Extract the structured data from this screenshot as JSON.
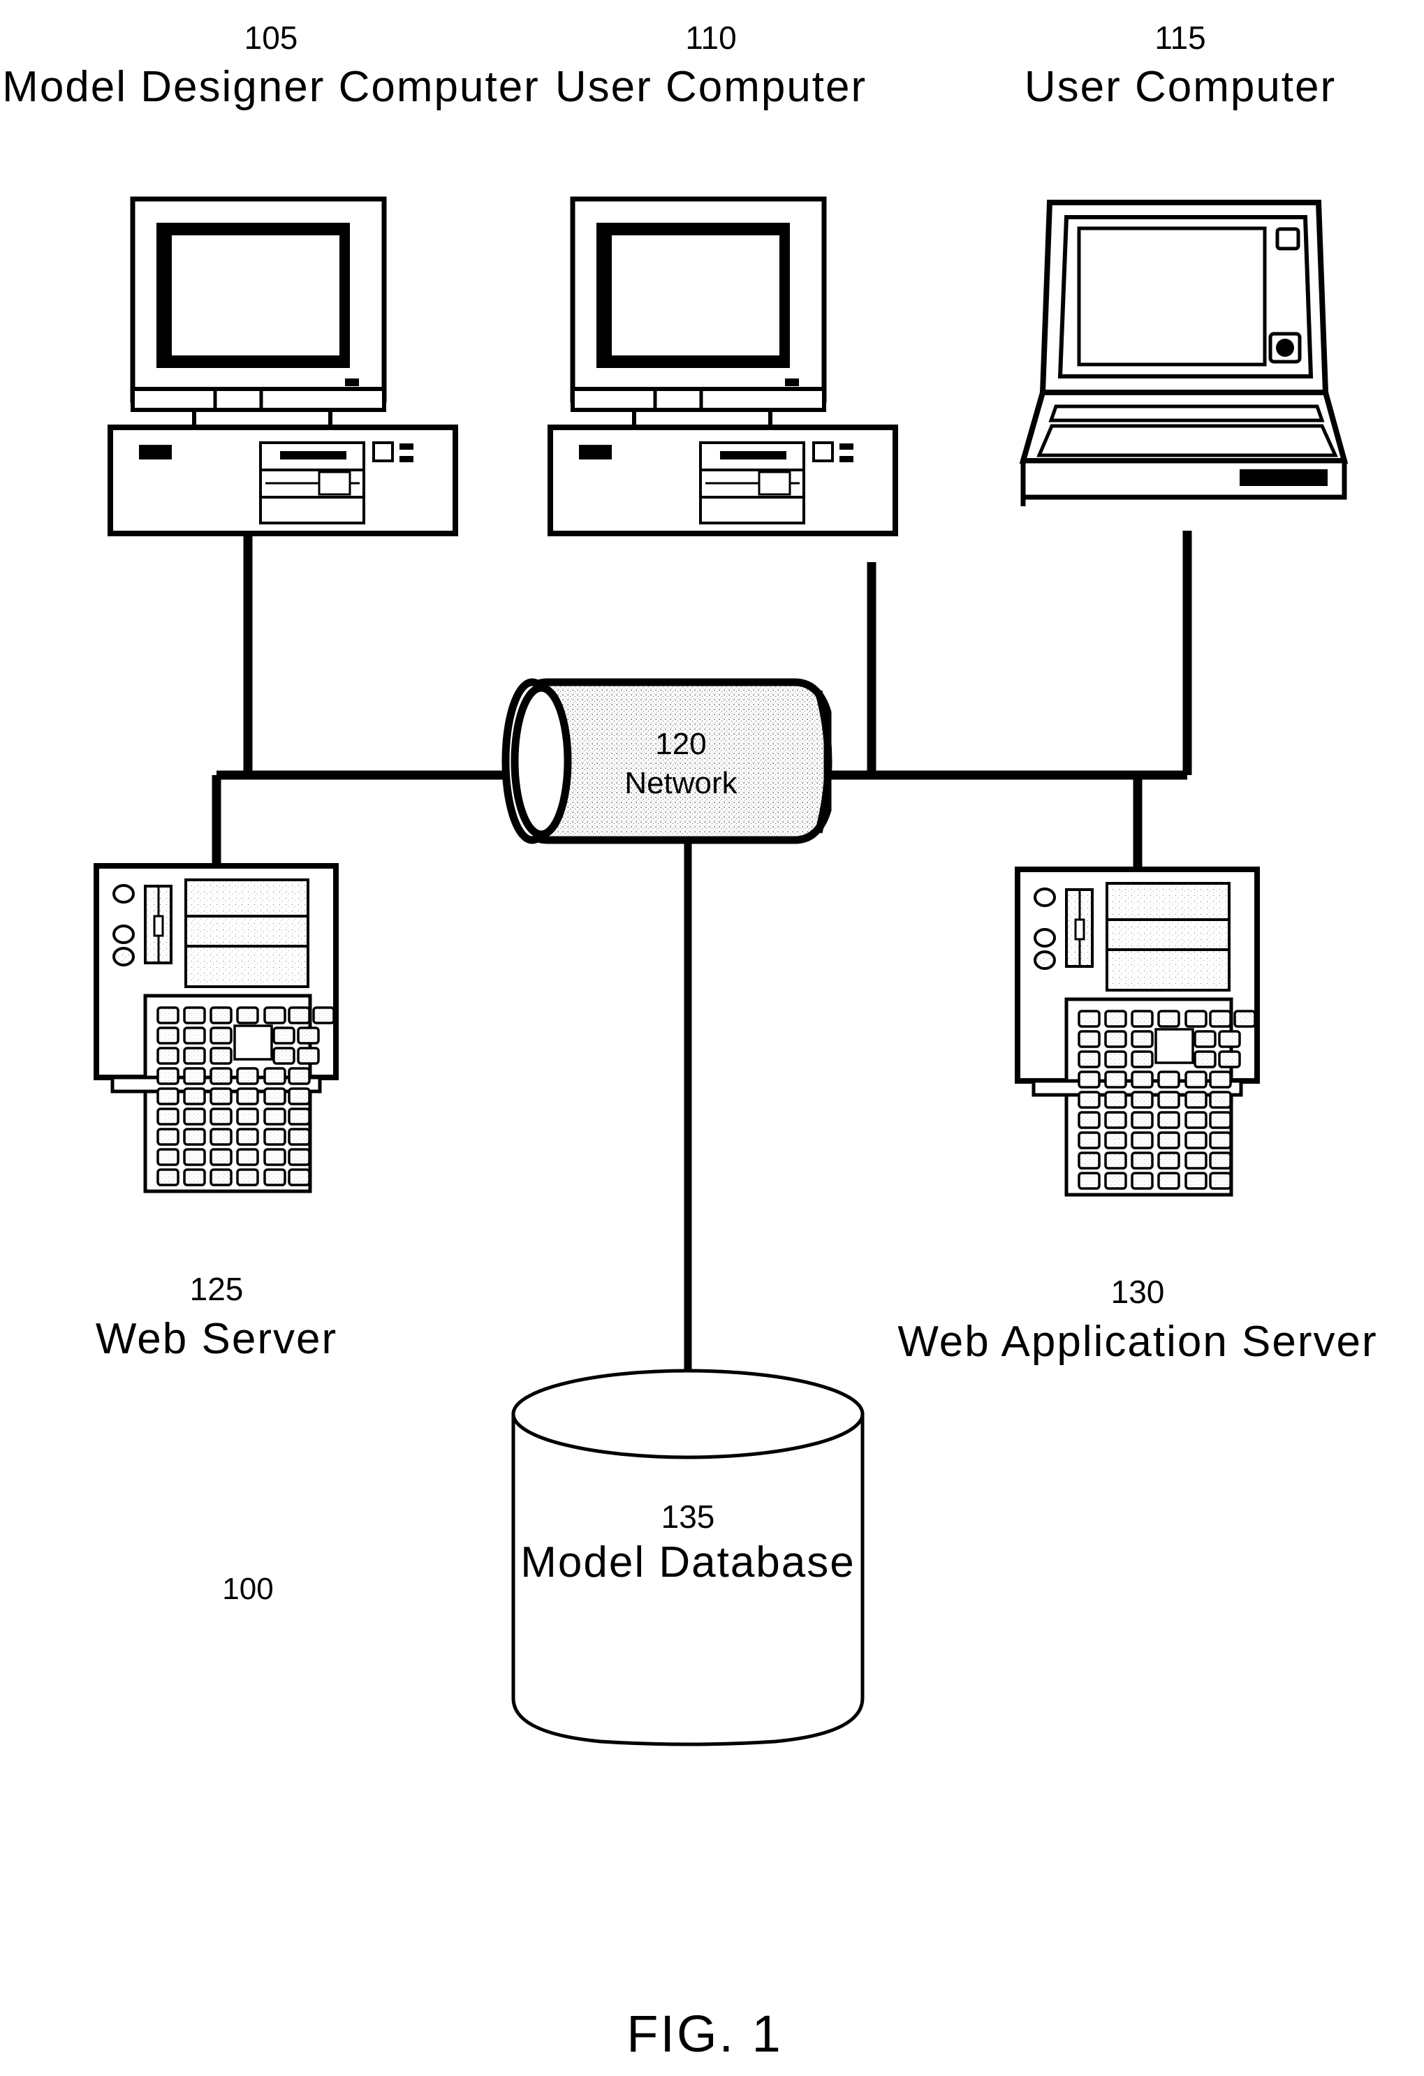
{
  "figure": {
    "caption": "FIG. 1",
    "system_ref": "100"
  },
  "nodes": [
    {
      "id": "model-designer-computer",
      "ref": "105",
      "label": "Model Designer Computer",
      "kind": "desktop-computer"
    },
    {
      "id": "user-computer-110",
      "ref": "110",
      "label": "User Computer",
      "kind": "desktop-computer"
    },
    {
      "id": "user-computer-115",
      "ref": "115",
      "label": "User Computer",
      "kind": "laptop-computer"
    },
    {
      "id": "network",
      "ref": "120",
      "label": "Network",
      "kind": "network-cylinder"
    },
    {
      "id": "web-server",
      "ref": "125",
      "label": "Web Server",
      "kind": "server-tower"
    },
    {
      "id": "web-application-server",
      "ref": "130",
      "label": "Web Application Server",
      "kind": "server-tower"
    },
    {
      "id": "model-database",
      "ref": "135",
      "label": "Model Database",
      "kind": "database-cylinder"
    }
  ],
  "connections": [
    {
      "from": "model-designer-computer",
      "to": "network"
    },
    {
      "from": "user-computer-110",
      "to": "network"
    },
    {
      "from": "user-computer-115",
      "to": "network"
    },
    {
      "from": "web-server",
      "to": "network"
    },
    {
      "from": "web-application-server",
      "to": "network"
    },
    {
      "from": "model-database",
      "to": "network"
    }
  ],
  "colors": {
    "ink": "#000000",
    "paper": "#ffffff",
    "stipple": "#c9c9c9"
  }
}
